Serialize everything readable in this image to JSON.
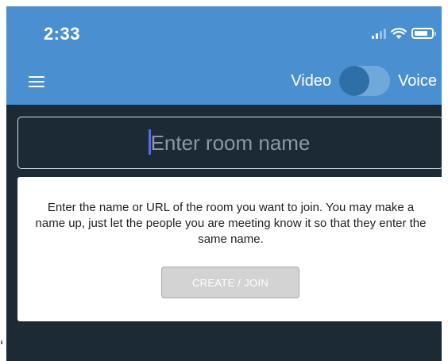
{
  "status_bar": {
    "time": "2:33",
    "icons": [
      "signal-icon",
      "wifi-icon",
      "battery-icon"
    ]
  },
  "header": {
    "menu_icon": "hamburger-menu-icon",
    "toggle": {
      "left_label": "Video",
      "right_label": "Voice",
      "selected": "Video"
    }
  },
  "room_input": {
    "placeholder": "Enter room name",
    "value": ""
  },
  "info_card": {
    "text": "Enter the name or URL of the room you want to join. You may make a name up, just let the people you are meeting know it so that they enter the same name.",
    "button_label": "CREATE / JOIN"
  },
  "colors": {
    "header_bg": "#4a90d0",
    "body_bg": "#1c2a36",
    "card_bg": "#ffffff",
    "button_bg": "#d3d3d3",
    "caret": "#5a6be0"
  }
}
